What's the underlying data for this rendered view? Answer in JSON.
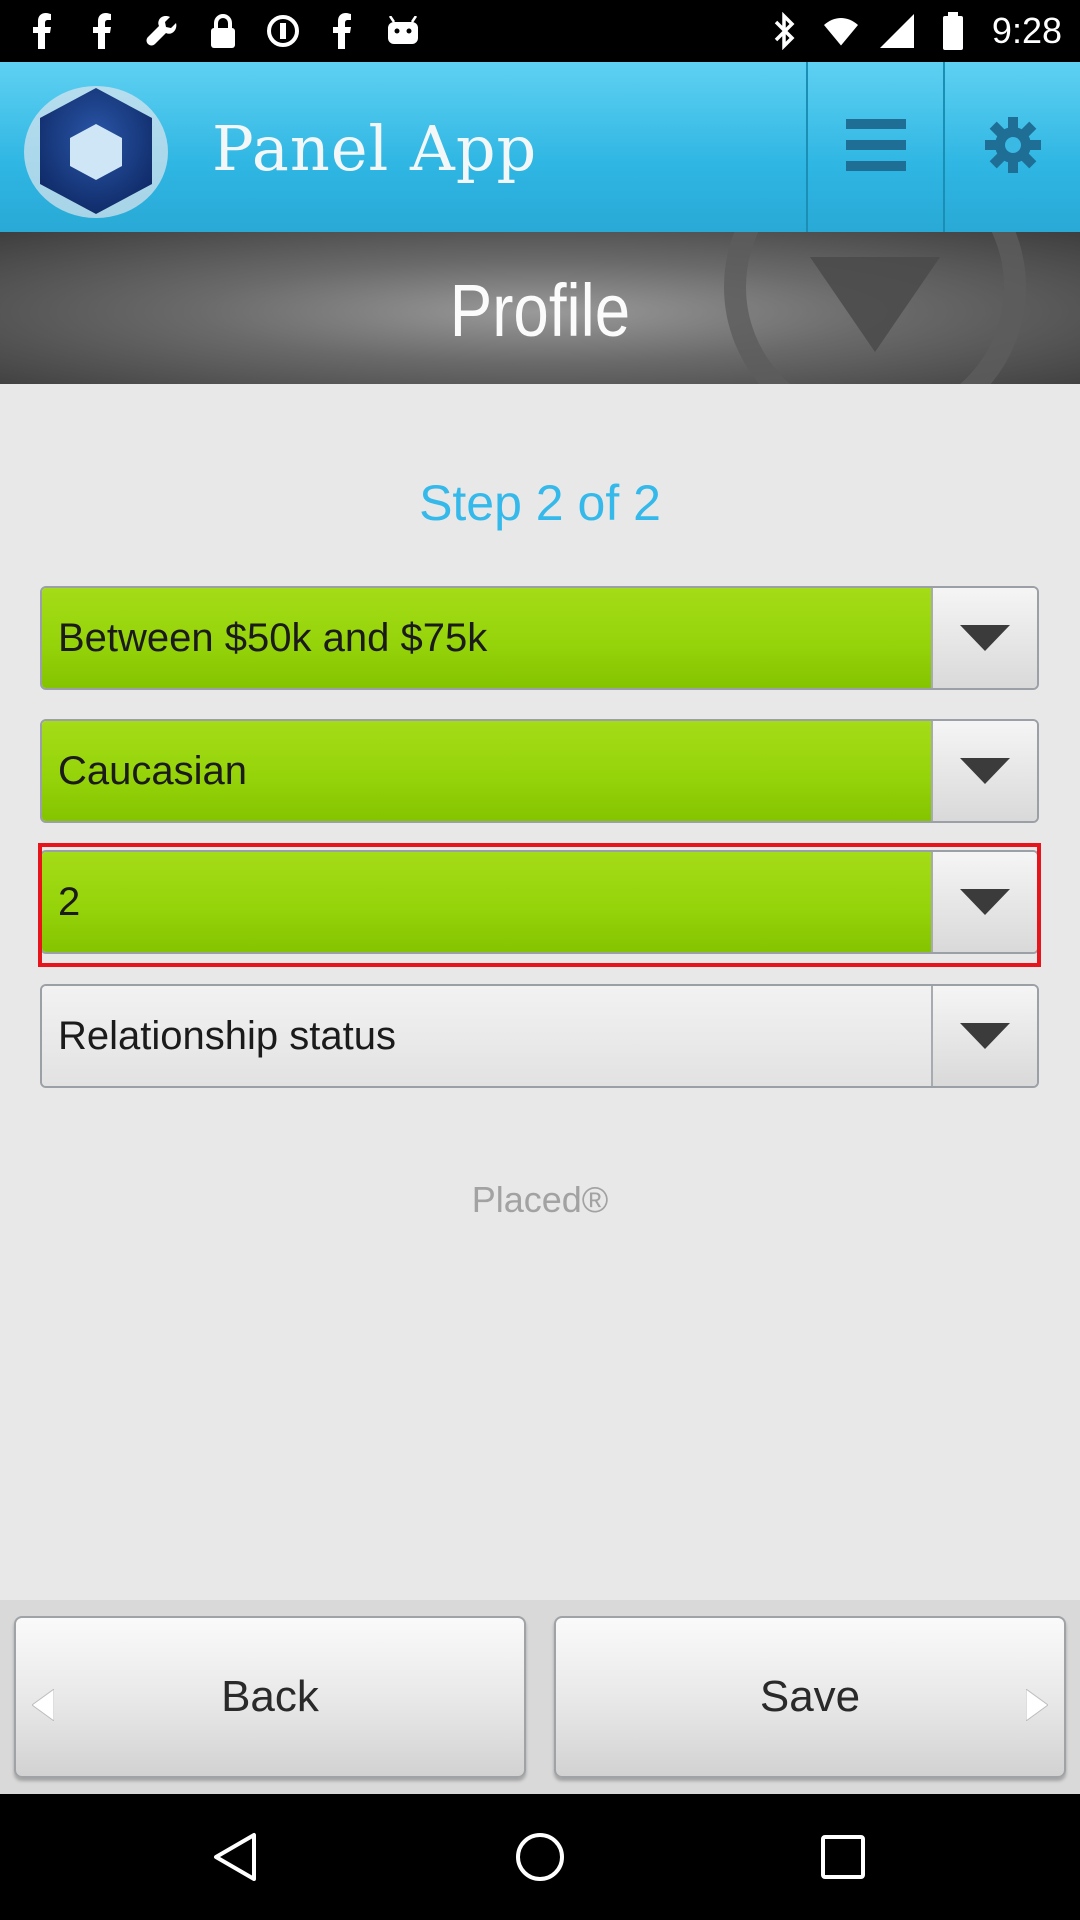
{
  "status_bar": {
    "time": "9:28",
    "left_icons": [
      "facebook-icon",
      "facebook-icon",
      "wrench-icon",
      "lock-icon",
      "circle-info-icon",
      "facebook-icon",
      "android-icon"
    ],
    "right_icons": [
      "bluetooth-icon",
      "wifi-icon",
      "signal-icon",
      "battery-icon"
    ]
  },
  "header": {
    "title": "Panel App",
    "logo_icon": "hexagon-logo-icon",
    "menu_icon": "menu-icon",
    "settings_icon": "gear-icon"
  },
  "banner": {
    "title": "Profile",
    "decor_icon": "triangle-down-icon"
  },
  "form": {
    "step_text": "Step 2 of 2",
    "dropdowns": [
      {
        "value": "Between $50k and $75k",
        "state": "selected"
      },
      {
        "value": "Caucasian",
        "state": "selected"
      },
      {
        "value": "2",
        "state": "selected-highlighted"
      },
      {
        "value": "Relationship status",
        "state": "placeholder"
      }
    ],
    "brand_text": "Placed®"
  },
  "bottom_bar": {
    "back_label": "Back",
    "save_label": "Save"
  },
  "system_nav": [
    "back-icon",
    "home-icon",
    "recents-icon"
  ],
  "colors": {
    "header": "#2fb6e3",
    "selected_dropdown": "#96d40a",
    "step_text": "#35b9ea",
    "highlight": "#e8141c"
  }
}
